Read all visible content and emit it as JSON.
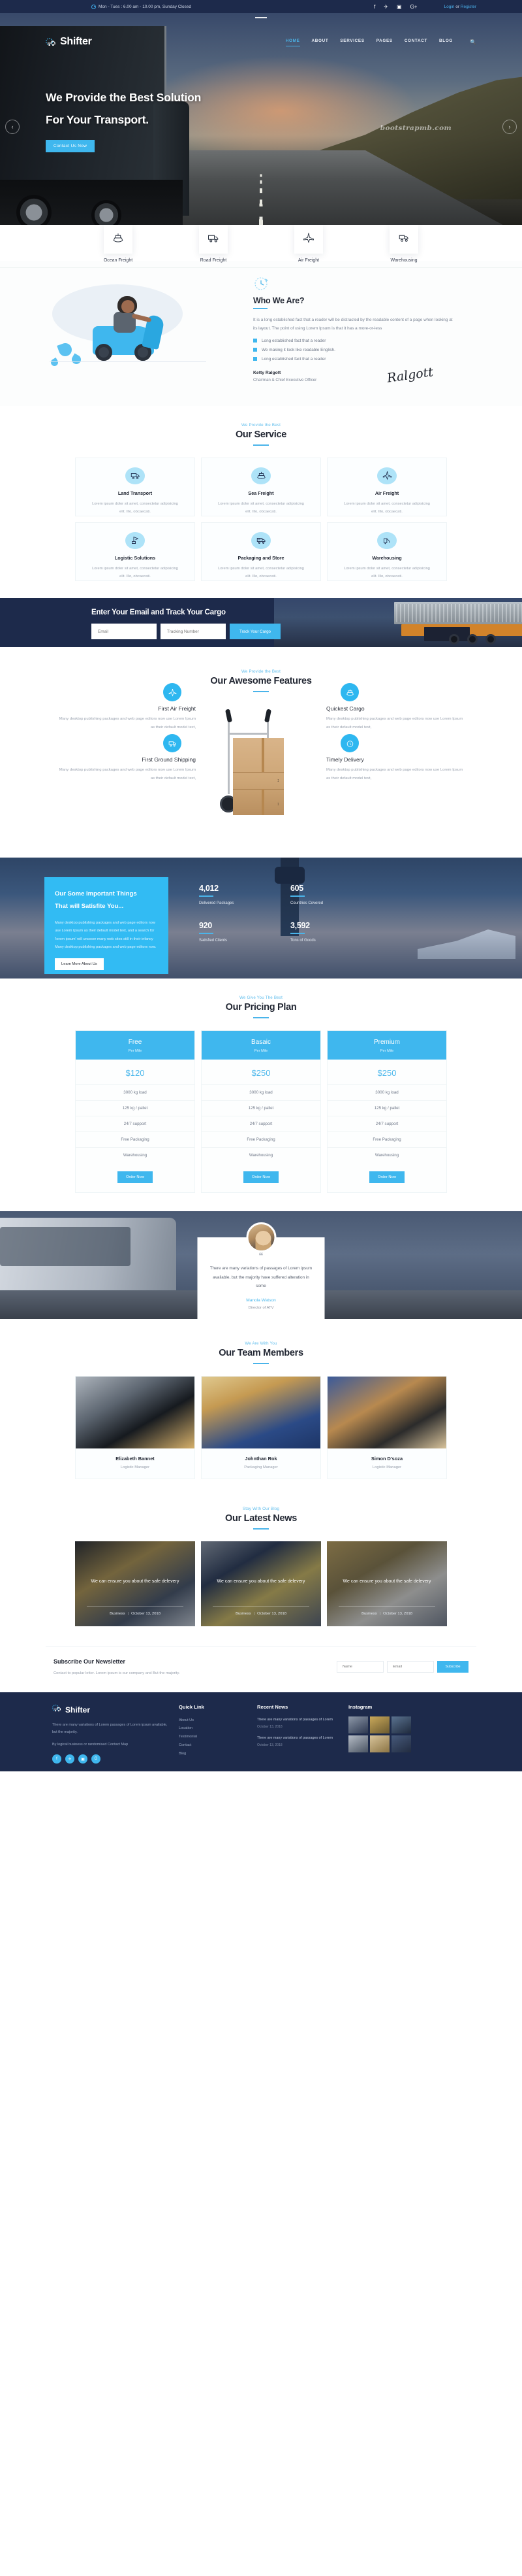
{
  "topbar": {
    "clock_icon": "clock-icon",
    "hours": "Mon - Tues : 6.00 am - 10.00 pm, Sunday Closed",
    "social": [
      {
        "name": "facebook-icon",
        "glyph": "f"
      },
      {
        "name": "twitter-icon",
        "glyph": "✈"
      },
      {
        "name": "instagram-icon",
        "glyph": "▣"
      },
      {
        "name": "google-plus-icon",
        "glyph": "G+"
      }
    ],
    "login": "Login",
    "or": "or",
    "register": "Register"
  },
  "nav": {
    "brand": "Shifter",
    "brand_icon": "truck-gear-logo-icon",
    "search_icon": "search-icon",
    "items": [
      {
        "label": "HOME",
        "active": true
      },
      {
        "label": "ABOUT",
        "active": false
      },
      {
        "label": "SERVICES",
        "active": false
      },
      {
        "label": "PAGES",
        "active": false
      },
      {
        "label": "CONTACT",
        "active": false
      },
      {
        "label": "BLOG",
        "active": false
      }
    ]
  },
  "hero": {
    "line1": "We Provide the Best Solution",
    "line2": "For Your Transport.",
    "cta": "Contact Us Now",
    "watermark": "bootstrapmb.com",
    "prev_icon": "chevron-left-icon",
    "next_icon": "chevron-right-icon"
  },
  "freight": [
    {
      "label": "Ocean Freight",
      "icon": "ship-icon"
    },
    {
      "label": "Road Freight",
      "icon": "truck-icon"
    },
    {
      "label": "Air Freight",
      "icon": "airplane-icon"
    },
    {
      "label": "Warehousing",
      "icon": "warehouse-truck-icon"
    }
  ],
  "about": {
    "illustration_name": "scooter-delivery-illustration",
    "badge_icon": "globe-clock-icon",
    "title": "Who We Are?",
    "paragraph": "It is a long established fact that a reader will be distracted by the readable content of a page when looking at its layout. The point of using Lorem Ipsum is that it has a more-or-less",
    "bullets": [
      "Long established fact that a reader",
      "We making it look like readable English.",
      "Long established fact that a reader"
    ],
    "signer_name": "Ketty Ralgott",
    "signer_role": "Chairman & Chief Executive Officer",
    "signature_glyph": "Ralgott"
  },
  "services": {
    "subtitle": "We Provide the Best",
    "title": "Our Service",
    "cards": [
      {
        "name": "Land Transport",
        "icon": "truck-icon",
        "text": "Lorem ipsum dolor sit amet, consectetur adipisicing elit. Illo, obcaecati."
      },
      {
        "name": "Sea Freight",
        "icon": "ship-icon",
        "text": "Lorem ipsum dolor sit amet, consectetur adipisicing elit. Illo, obcaecati."
      },
      {
        "name": "Air Freight",
        "icon": "airplane-icon",
        "text": "Lorem ipsum dolor sit amet, consectetur adipisicing elit. Illo, obcaecati."
      },
      {
        "name": "Logistic Solutions",
        "icon": "crane-icon",
        "text": "Lorem ipsum dolor sit amet, consectetur adipisicing elit. Illo, obcaecati."
      },
      {
        "name": "Packaging and Store",
        "icon": "delivery-truck-icon",
        "text": "Lorem ipsum dolor sit amet, consectetur adipisicing elit. Illo, obcaecati."
      },
      {
        "name": "Warehousing",
        "icon": "forklift-icon",
        "text": "Lorem ipsum dolor sit amet, consectetur adipisicing elit. Illo, obcaecati."
      }
    ]
  },
  "track": {
    "title": "Enter Your Email and Track Your Cargo",
    "email_placeholder": "Email",
    "tracking_placeholder": "Tracking Number",
    "button": "Track Your Cargo"
  },
  "features": {
    "subtitle": "We Provide the Best",
    "title": "Our Awesome Features",
    "illustration_name": "hand-truck-with-box-illustration",
    "left": [
      {
        "name": "First Air Freight",
        "icon": "airplane-icon",
        "text": "Many desktop publishing packages and web page editors now use Lorem Ipsum as their default model text,"
      },
      {
        "name": "First Ground Shipping",
        "icon": "truck-icon",
        "text": "Many desktop publishing packages and web page editors now use Lorem Ipsum as their default model text,"
      }
    ],
    "right": [
      {
        "name": "Quickest Cargo",
        "icon": "ship-icon",
        "text": "Many desktop publishing packages and web page editors now use Lorem Ipsum as their default model text,"
      },
      {
        "name": "Timely Delivery",
        "icon": "stopwatch-icon",
        "text": "Many desktop publishing packages and web page editors now use Lorem Ipsum as their default model text,"
      }
    ]
  },
  "counters": {
    "panel_title_1": "Our Some Important Things",
    "panel_title_2": "That will Satisfite You...",
    "panel_text": "Many desktop publishing packages and web page editors now use Lorem Ipsum as their default model text, and a search for 'lorem ipsum' will uncover many web sites still in their infancy Many desktop publishing packages and web page editors now.",
    "panel_button": "Learn More About Us",
    "stats": [
      {
        "value": "4,012",
        "label": "Delivered Packages"
      },
      {
        "value": "605",
        "label": "Countries Covered"
      },
      {
        "value": "920",
        "label": "Satisfied Clients"
      },
      {
        "value": "3,592",
        "label": "Tons of Goods"
      }
    ]
  },
  "pricing": {
    "subtitle": "We Give You The Best",
    "title": "Our Pricing Plan",
    "plans": [
      {
        "name": "Free",
        "sub": "Per Mile",
        "amount": "$120",
        "rows": [
          "3000 kg load",
          "125 kg / pallet",
          "24/7 support",
          "Free Packaging",
          "Warehousing"
        ],
        "cta": "Order Now"
      },
      {
        "name": "Basaic",
        "sub": "Per Mile",
        "amount": "$250",
        "rows": [
          "3000 kg load",
          "125 kg / pallet",
          "24/7 support",
          "Free Packaging",
          "Warehousing"
        ],
        "cta": "Order Now"
      },
      {
        "name": "Premium",
        "sub": "Per Mile",
        "amount": "$250",
        "rows": [
          "3000 kg load",
          "125 kg / pallet",
          "24/7 support",
          "Free Packaging",
          "Warehousing"
        ],
        "cta": "Order Now"
      }
    ]
  },
  "testimonial": {
    "avatar_name": "client-avatar",
    "quote_icon": "quote-icon",
    "text": "There are many variations of passages of Lorem ipsum available, but the majority have suffered alteration in some",
    "author": "Manola Watson",
    "role": "Director of ATV"
  },
  "team": {
    "subtitle": "We Are With You",
    "title": "Our Team Members",
    "members": [
      {
        "name": "Elizabeth Bannet",
        "role": "Logistic Manager",
        "photo": "team-photo-1"
      },
      {
        "name": "Johnthan Rok",
        "role": "Packaging Manager",
        "photo": "team-photo-2"
      },
      {
        "name": "Simon D'soza",
        "role": "Logistic Manager",
        "photo": "team-photo-3"
      }
    ]
  },
  "news": {
    "subtitle": "Stay With Our Blog",
    "title": "Our Latest News",
    "posts": [
      {
        "title": "We can ensure you about the safe delevery",
        "category": "Business",
        "date": "October 13, 2018"
      },
      {
        "title": "We can ensure you about the safe delevery",
        "category": "Business",
        "date": "October 13, 2018"
      },
      {
        "title": "We can ensure you about the safe delevery",
        "category": "Business",
        "date": "October 13, 2018"
      }
    ]
  },
  "newsletter": {
    "title": "Subscribe Our Newsletter",
    "text": "Contact to popular letter. Lorem ipsum is our company and But the majority.",
    "name_placeholder": "Name",
    "email_placeholder": "Email",
    "button": "Subscribe"
  },
  "footer": {
    "brand": "Shifter",
    "brand_icon": "truck-gear-logo-icon",
    "about": "There are many variations of Lorem passages of Lorem ipsum available, but the majority.",
    "subtext": "By logical business or randomised Contact Map",
    "social": [
      {
        "name": "facebook-icon",
        "glyph": "f"
      },
      {
        "name": "twitter-icon",
        "glyph": "✈"
      },
      {
        "name": "instagram-icon",
        "glyph": "▣"
      },
      {
        "name": "google-plus-icon",
        "glyph": "G"
      }
    ],
    "quick_link_title": "Quick Link",
    "quick_links": [
      "About Us",
      "Location",
      "Testimonial",
      "Contact",
      "Blog"
    ],
    "recent_news_title": "Recent News",
    "recent_news": [
      {
        "title": "There are many variations of passages of Lorem",
        "date": "October 13, 2018"
      },
      {
        "title": "There are many variations of passages of Lorem",
        "date": "October 13, 2018"
      }
    ],
    "instagram_title": "Instagram"
  },
  "colors": {
    "accent": "#3fb7ee",
    "dark": "#1d2a4b",
    "link": "#4ab4ea"
  }
}
